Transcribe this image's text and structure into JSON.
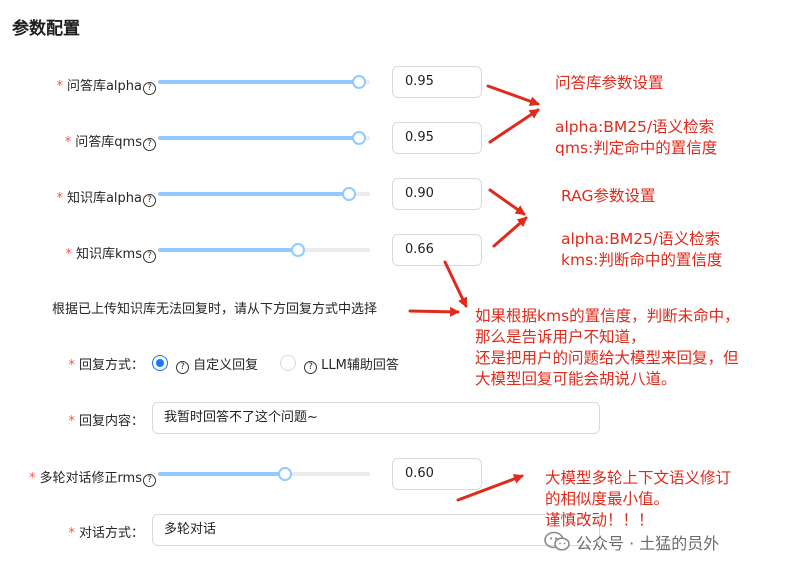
{
  "page": {
    "title": "参数配置"
  },
  "form": {
    "qa_alpha": {
      "label": "问答库alpha",
      "value": "0.95",
      "fraction": 0.95
    },
    "qa_qms": {
      "label": "问答库qms",
      "value": "0.95",
      "fraction": 0.95
    },
    "kb_alpha": {
      "label": "知识库alpha",
      "value": "0.90",
      "fraction": 0.9
    },
    "kb_kms": {
      "label": "知识库kms",
      "value": "0.66",
      "fraction": 0.66
    },
    "fallback_hint": "根据已上传知识库无法回复时，请从下方回复方式中选择",
    "reply_mode": {
      "label": "回复方式：",
      "options": [
        {
          "label": "自定义回复",
          "selected": true
        },
        {
          "label": "LLM辅助回答",
          "selected": false
        }
      ]
    },
    "reply_content": {
      "label": "回复内容：",
      "value": "我暂时回答不了这个问题~"
    },
    "multiturn_rms": {
      "label": "多轮对话修正rms",
      "value": "0.60",
      "fraction": 0.6
    },
    "dialog_mode": {
      "label": "对话方式：",
      "value": "多轮对话"
    },
    "required_mark": "*",
    "help_glyph": "?"
  },
  "annotations": {
    "qa_title": "问答库参数设置",
    "qa_desc_1": "alpha:BM25/语义检索",
    "qa_desc_2": "qms:判定命中的置信度",
    "rag_title": "RAG参数设置",
    "rag_desc_1": "alpha:BM25/语义检索",
    "rag_desc_2": "kms:判断命中的置信度",
    "fallback_1": "如果根据kms的置信度，判断未命中，",
    "fallback_2": "那么是告诉用户不知道，",
    "fallback_3": "还是把用户的问题给大模型来回复，但",
    "fallback_4": "大模型回复可能会胡说八道。",
    "multi_1": "大模型多轮上下文语义修订",
    "multi_2": "的相似度最小值。",
    "multi_3": "谨慎改动！！！"
  },
  "watermark": {
    "text": "公众号 · 土猛的员外"
  },
  "colors": {
    "accent": "#1677ff",
    "slider": "#91caff",
    "annotation": "#e02a1b",
    "required": "#ff4d4f"
  }
}
